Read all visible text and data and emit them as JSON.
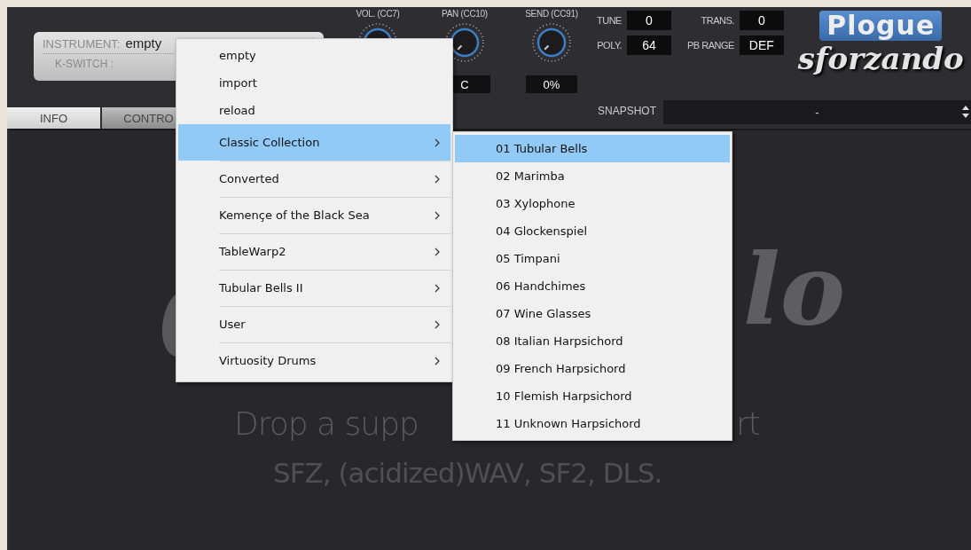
{
  "instrument": {
    "label": "INSTRUMENT:",
    "value": "empty",
    "kswitch_label": "K-SWITCH :"
  },
  "knobs": [
    {
      "label": "VOL. (CC7)"
    },
    {
      "label": "PAN (CC10)",
      "value": "C"
    },
    {
      "label": "SEND (CC91)",
      "value": "0%"
    }
  ],
  "params": [
    {
      "label": "TUNE",
      "value": "0"
    },
    {
      "label": "TRANS.",
      "value": "0"
    },
    {
      "label": "POLY.",
      "value": "64"
    },
    {
      "label": "PB RANGE",
      "value": "DEF"
    }
  ],
  "logo": {
    "brand": "Plogue",
    "product": "sforzando"
  },
  "tabs": [
    {
      "label": "INFO",
      "selected": true
    },
    {
      "label": "CONTRO",
      "selected": false
    }
  ],
  "snapshot": {
    "label": "SNAPSHOT",
    "value": "-"
  },
  "drop_zone": {
    "watermark": "lo",
    "line_1_parts": [
      "Drop a supp",
      "rt"
    ],
    "line_2": "SFZ, (acidized)WAV, SF2, DLS."
  },
  "menu": {
    "items": [
      {
        "label": "empty",
        "kind": "action",
        "selected": false
      },
      {
        "label": "import",
        "kind": "action",
        "selected": false
      },
      {
        "label": "reload",
        "kind": "action",
        "selected": false
      },
      {
        "label": "Classic Collection",
        "kind": "submenu",
        "selected": true
      },
      {
        "label": "Converted",
        "kind": "submenu",
        "selected": false
      },
      {
        "label": "Kemençe of the Black Sea",
        "kind": "submenu",
        "selected": false
      },
      {
        "label": "TableWarp2",
        "kind": "submenu",
        "selected": false
      },
      {
        "label": "Tubular Bells II",
        "kind": "submenu",
        "selected": false
      },
      {
        "label": "User",
        "kind": "submenu",
        "selected": false
      },
      {
        "label": "Virtuosity Drums",
        "kind": "submenu",
        "selected": false
      }
    ]
  },
  "submenu": {
    "items": [
      {
        "label": "01 Tubular Bells",
        "selected": true
      },
      {
        "label": "02 Marimba",
        "selected": false
      },
      {
        "label": "03 Xylophone",
        "selected": false
      },
      {
        "label": "04 Glockenspiel",
        "selected": false
      },
      {
        "label": "05 Timpani",
        "selected": false
      },
      {
        "label": "06 Handchimes",
        "selected": false
      },
      {
        "label": "07 Wine Glasses",
        "selected": false
      },
      {
        "label": "08 Italian Harpsichord",
        "selected": false
      },
      {
        "label": "09 French Harpsichord",
        "selected": false
      },
      {
        "label": "10 Flemish Harpsichord",
        "selected": false
      },
      {
        "label": "11 Unknown Harpsichord",
        "selected": false
      }
    ]
  }
}
